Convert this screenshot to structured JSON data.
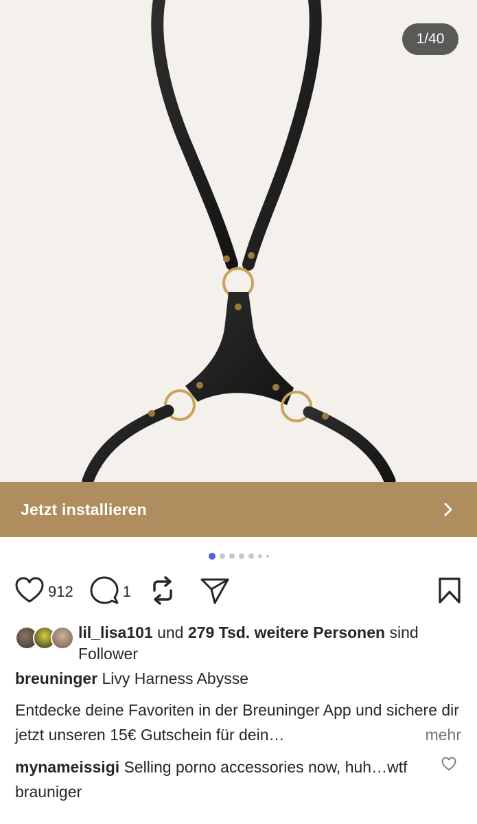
{
  "post": {
    "image_counter": "1/40",
    "cta_label": "Jetzt installieren",
    "carousel": {
      "total_dots": 6,
      "active_index": 0
    }
  },
  "actions": {
    "like_count": "912",
    "comment_count": "1"
  },
  "followers": {
    "username": "lil_lisa101",
    "connector": " und ",
    "count_text": "279 Tsd. weitere Personen",
    "suffix": " sind Follower"
  },
  "caption": {
    "username": "breuninger",
    "text": " Livy Harness Abysse",
    "description": "Entdecke deine Favoriten in der Breuninger App und sichere dir jetzt unseren 15€ Gutschein für dein…",
    "more_label": "mehr"
  },
  "comment": {
    "username": "mynameissigi",
    "text": " Selling porno accessories now, huh…wtf brauniger"
  },
  "colors": {
    "cta_background": "#b08d5e",
    "image_background": "#f4f0eb",
    "active_dot": "#5b5bdf"
  },
  "icons": [
    "heart-icon",
    "comment-icon",
    "repost-icon",
    "send-icon",
    "bookmark-icon",
    "chevron-right-icon"
  ]
}
